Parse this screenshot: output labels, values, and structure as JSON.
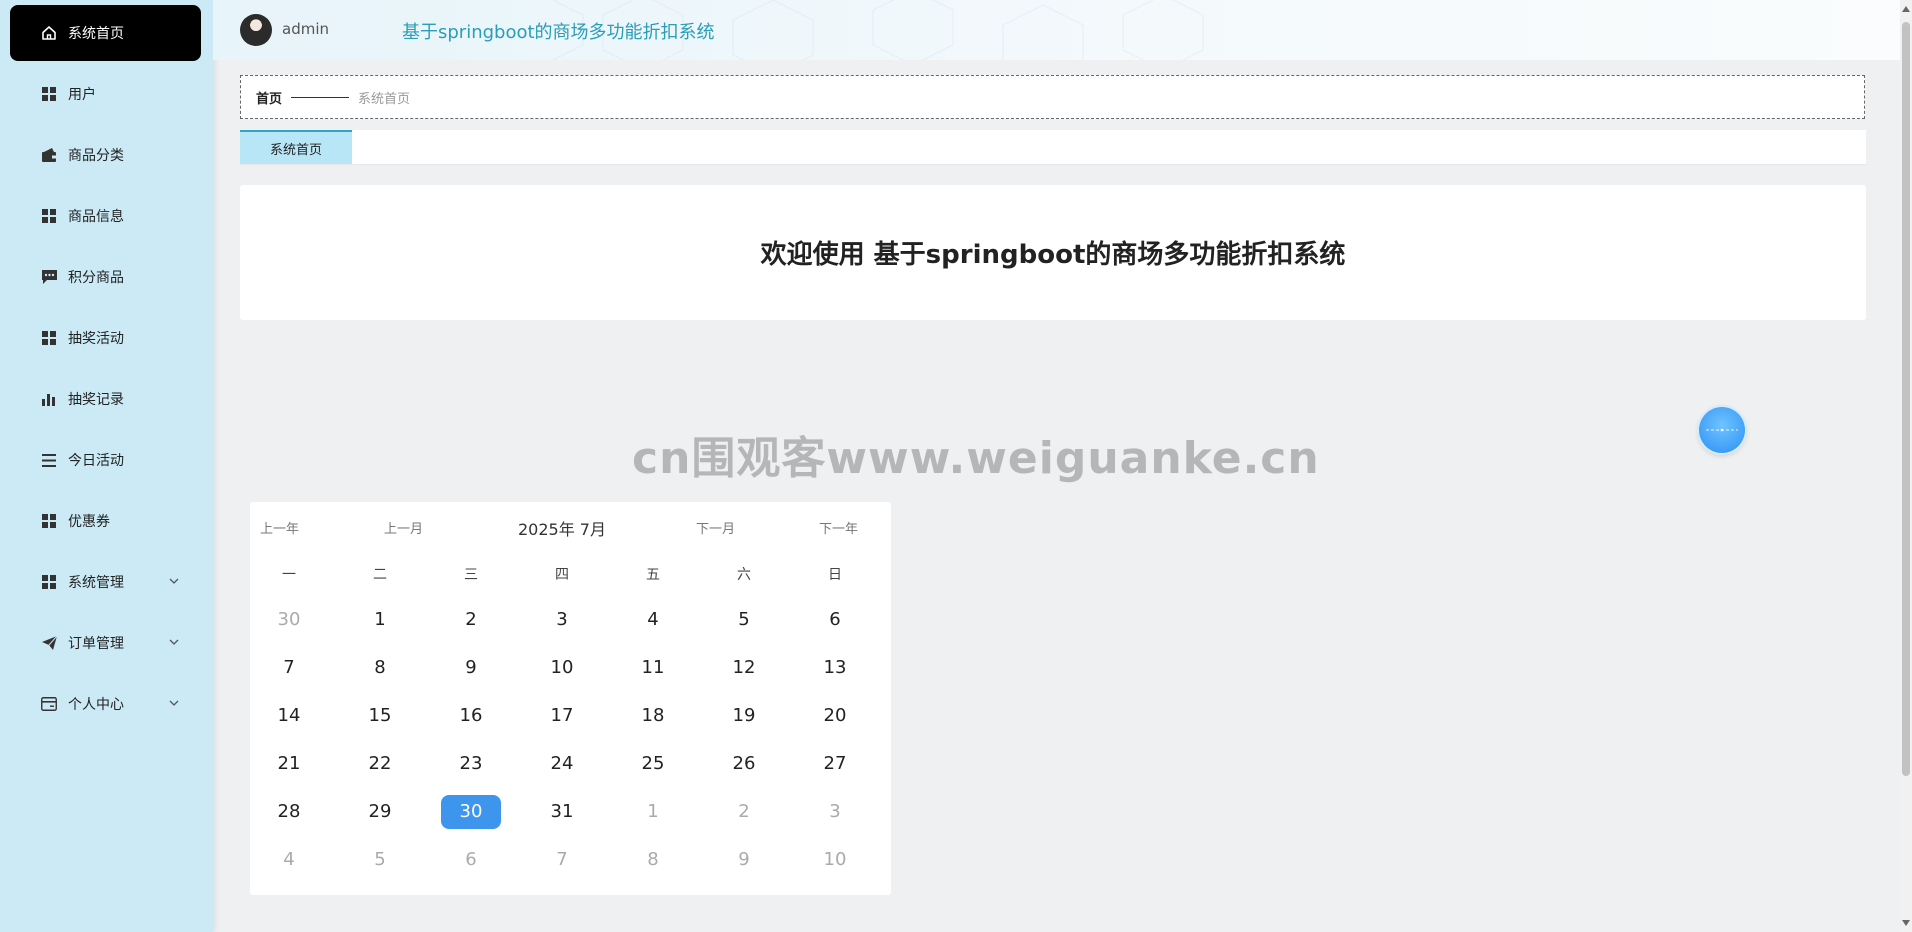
{
  "sidebar": {
    "items": [
      {
        "label": "系统首页",
        "icon": "home-icon",
        "active": true
      },
      {
        "label": "用户",
        "icon": "grid-icon"
      },
      {
        "label": "商品分类",
        "icon": "wallet-icon"
      },
      {
        "label": "商品信息",
        "icon": "grid-icon"
      },
      {
        "label": "积分商品",
        "icon": "chat-icon"
      },
      {
        "label": "抽奖活动",
        "icon": "grid-icon"
      },
      {
        "label": "抽奖记录",
        "icon": "bar-chart-icon"
      },
      {
        "label": "今日活动",
        "icon": "list-icon"
      },
      {
        "label": "优惠券",
        "icon": "grid-icon"
      },
      {
        "label": "系统管理",
        "icon": "grid-icon",
        "expandable": true
      },
      {
        "label": "订单管理",
        "icon": "send-icon",
        "expandable": true
      },
      {
        "label": "个人中心",
        "icon": "card-icon",
        "expandable": true
      }
    ]
  },
  "header": {
    "username": "admin",
    "title": "基于springboot的商场多功能折扣系统"
  },
  "breadcrumb": {
    "home": "首页",
    "current": "系统首页"
  },
  "tabs": [
    {
      "label": "系统首页",
      "active": true
    }
  ],
  "welcome": {
    "text": "欢迎使用 基于springboot的商场多功能折扣系统"
  },
  "watermark": "cn围观客www.weiguanke.cn",
  "calendar": {
    "prev_year": "上一年",
    "prev_month": "上一月",
    "title": "2025年 7月",
    "next_month": "下一月",
    "next_year": "下一年",
    "weekdays": [
      "一",
      "二",
      "三",
      "四",
      "五",
      "六",
      "日"
    ],
    "weeks": [
      [
        30,
        1,
        2,
        3,
        4,
        5,
        6
      ],
      [
        7,
        8,
        9,
        10,
        11,
        12,
        13
      ],
      [
        14,
        15,
        16,
        17,
        18,
        19,
        20
      ],
      [
        21,
        22,
        23,
        24,
        25,
        26,
        27
      ],
      [
        28,
        29,
        30,
        31,
        1,
        2,
        3
      ],
      [
        4,
        5,
        6,
        7,
        8,
        9,
        10
      ]
    ],
    "today": 30
  },
  "colors": {
    "sidebar_bg": "#cbeaf6",
    "active_item_bg": "#000000",
    "title_color": "#2a9db7",
    "today_bg": "#3d95ed",
    "tab_bg": "#b9e6f7"
  }
}
